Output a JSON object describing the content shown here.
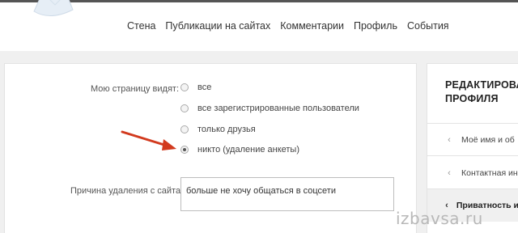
{
  "nav": {
    "items": [
      "Стена",
      "Публикации на сайтах",
      "Комментарии",
      "Профиль",
      "События"
    ]
  },
  "visibility": {
    "label": "Мою страницу видят:",
    "options": [
      {
        "label": "все",
        "checked": false
      },
      {
        "label": "все зарегистрированные пользователи",
        "checked": false
      },
      {
        "label": "только друзья",
        "checked": false
      },
      {
        "label": "никто (удаление анкеты)",
        "checked": true
      }
    ]
  },
  "reason": {
    "label": "Причина удаления с сайта",
    "value": "больше не хочу общаться в соцсети"
  },
  "sidebar": {
    "title": "РЕДАКТИРОВАНИЕ ПРОФИЛЯ",
    "title_line1": "РЕДАКТИРОВА",
    "title_line2": "ПРОФИЛЯ",
    "items": [
      {
        "label": "Моё имя и об",
        "active": false
      },
      {
        "label": "Контактная ин",
        "active": false
      },
      {
        "label": "Приватность и",
        "active": true
      }
    ]
  },
  "watermark": "izbavsa.ru",
  "colors": {
    "arrow": "#d23a1e",
    "header_bg": "#ffffff",
    "page_bg": "#f0f0f0"
  }
}
